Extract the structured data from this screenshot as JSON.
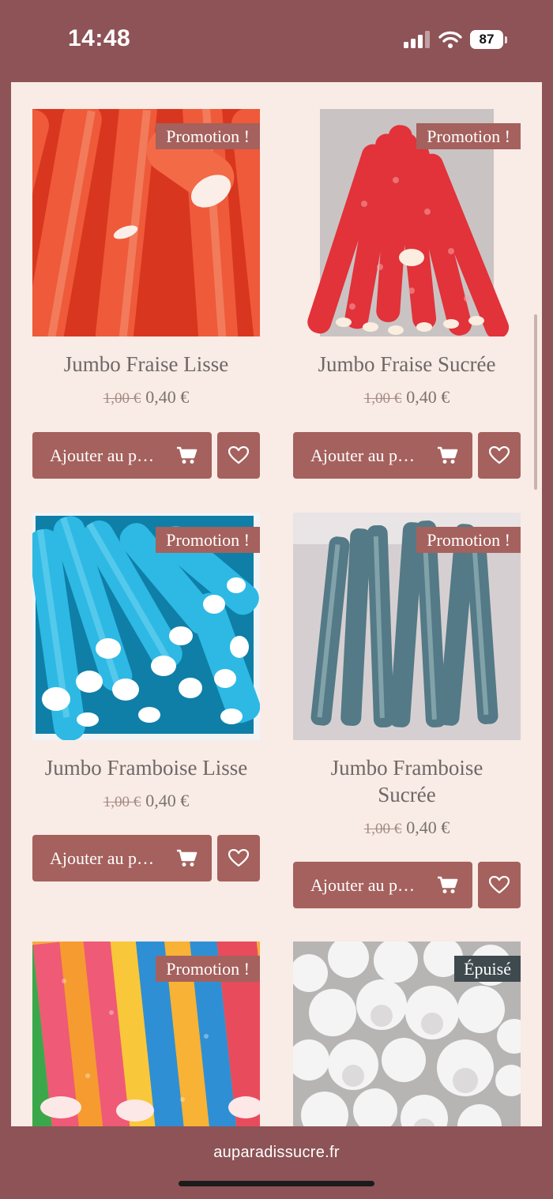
{
  "status": {
    "time": "14:48",
    "battery": "87"
  },
  "products": [
    {
      "title_lines": [
        "Jumbo Fraise Lisse"
      ],
      "badge": "Promotion !",
      "old_price": "1,00 €",
      "price": "0,40 €",
      "add_label": "Ajouter au p…"
    },
    {
      "title_lines": [
        "Jumbo Fraise Sucrée"
      ],
      "badge": "Promotion !",
      "old_price": "1,00 €",
      "price": "0,40 €",
      "add_label": "Ajouter au p…"
    },
    {
      "title_lines": [
        "Jumbo Framboise Lisse"
      ],
      "badge": "Promotion !",
      "old_price": "1,00 €",
      "price": "0,40 €",
      "add_label": "Ajouter au p…"
    },
    {
      "title_lines": [
        "Jumbo Framboise",
        "Sucrée"
      ],
      "badge": "Promotion !",
      "old_price": "1,00 €",
      "price": "0,40 €",
      "add_label": "Ajouter au p…"
    },
    {
      "badge": "Promotion !"
    },
    {
      "badge": "Épuisé"
    }
  ],
  "browser": {
    "url": "auparadissucre.fr"
  },
  "icons": {
    "cart": "cart-icon",
    "favorite": "heart-icon",
    "signal": "cellular-signal-icon",
    "wifi": "wifi-icon"
  }
}
